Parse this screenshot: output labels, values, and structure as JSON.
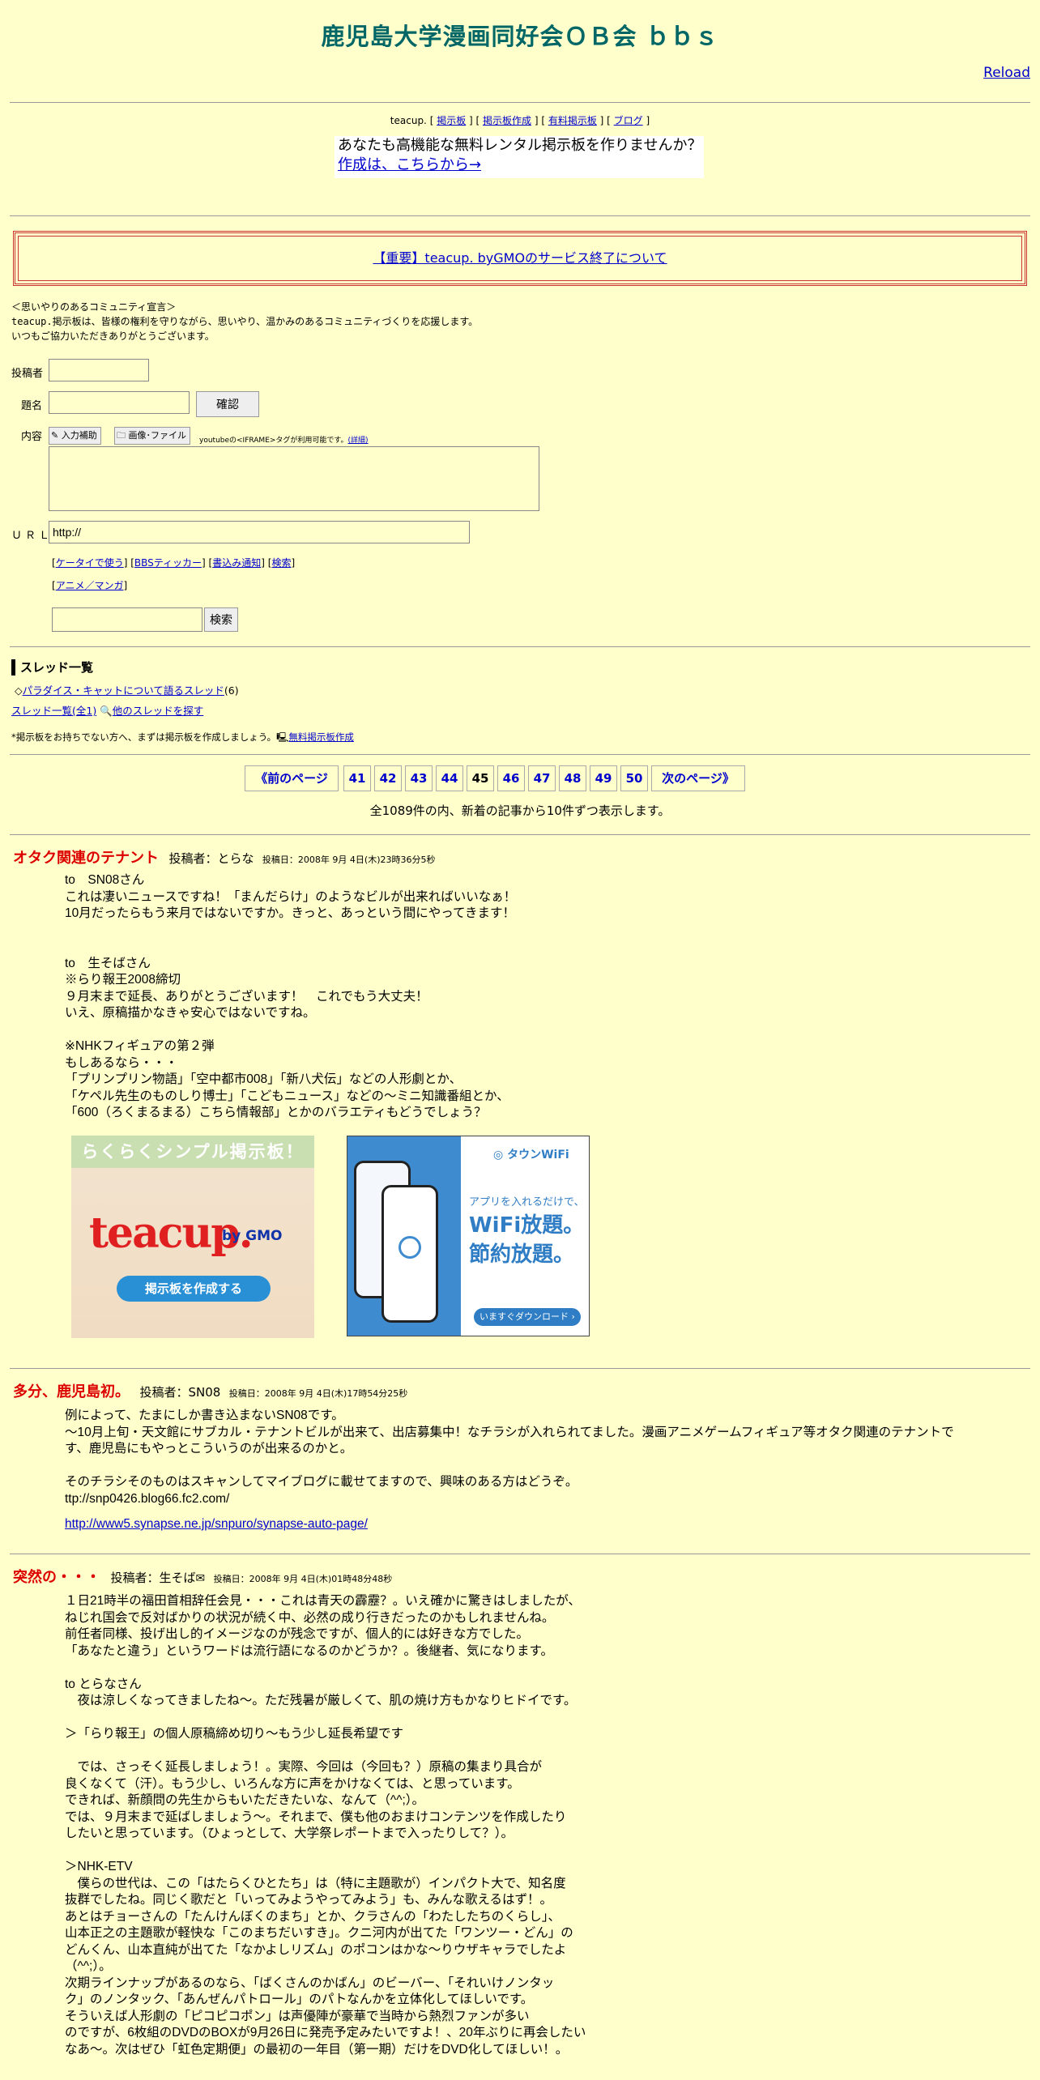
{
  "header": {
    "title": "鹿児島大学漫画同好会ＯＢ会 ｂｂｓ",
    "reload": "Reload"
  },
  "teacup_bar": {
    "prefix": "teacup.",
    "links": [
      "掲示板",
      "掲示板作成",
      "有料掲示板",
      "ブログ"
    ]
  },
  "ad": {
    "line1": "あなたも高機能な無料レンタル掲示板を作りませんか？",
    "line2": "作成は、こちらから→"
  },
  "notice": "【重要】teacup. byGMOのサービス終了について",
  "declaration": [
    "＜思いやりのあるコミュニティ宣言＞",
    "teacup.掲示板は、皆様の権利を守りながら、思いやり、温かみのあるコミュニティづくりを応援します。",
    "いつもご協力いただきありがとうございます。"
  ],
  "form": {
    "author_label": "投稿者",
    "subject_label": "題名",
    "confirm_button": "確認",
    "body_label": "内容",
    "input_help": "入力補助",
    "image_file": "画像･ファイル",
    "youtube_note": "youtubeの<IFRAME>タグが利用可能です。",
    "details": "(詳細)",
    "url_label": "ＵＲＬ",
    "url_value": "http://",
    "links1": [
      "ケータイで使う",
      "BBSティッカー",
      "書込み通知",
      "検索"
    ],
    "links2": [
      "アニメ／マンガ"
    ],
    "search_button": "検索"
  },
  "threads": {
    "title": "スレッド一覧",
    "item_prefix": "◇",
    "item_label": "パラダイス・キャットについて語るスレッド",
    "item_count": "(6)",
    "all_label": "スレッド一覧(全1)",
    "other_label": "他のスレッドを探す",
    "create_note": "*掲示板をお持ちでない方へ、まずは掲示板を作成しましょう。",
    "create_link": "無料掲示板作成"
  },
  "pager": {
    "prev": "《前のページ",
    "pages": [
      "41",
      "42",
      "43",
      "44",
      "45",
      "46",
      "47",
      "48",
      "49",
      "50"
    ],
    "current": "45",
    "next": "次のページ》",
    "summary": "全1089件の内、新着の記事から10件ずつ表示します。"
  },
  "posts": [
    {
      "title": "オタク関連のテナント",
      "author": "投稿者：とらな",
      "date": "投稿日：2008年 9月 4日(木)23時36分5秒",
      "body": "to　SN08さん\nこれは凄いニュースですね！「まんだらけ」のようなビルが出来ればいいなぁ！\n10月だったらもう来月ではないですか。きっと、あっという間にやってきます！\n\n\nto　生そばさん\n※らり報王2008締切\n９月末まで延長、ありがとうございます！　これでもう大丈夫！\nいえ、原稿描かなきゃ安心ではないですね。\n\n※NHKフィギュアの第２弾\nもしあるなら・・・\n「プリンプリン物語」「空中都市008」「新八犬伝」などの人形劇とか、\n「ケペル先生のものしり博士」「こどもニュース」などの～ミニ知識番組とか、\n「600（ろくまるまる）こちら情報部」とかのバラエティもどうでしょう？"
    },
    {
      "title": "多分、鹿児島初。",
      "author": "投稿者：SN08",
      "date": "投稿日：2008年 9月 4日(木)17時54分25秒",
      "body": "例によって、たまにしか書き込まないSN08です。\n～10月上旬・天文館にサブカル・テナントビルが出来て、出店募集中！なチラシが入れられてました。漫画アニメゲームフィギュア等オタク関連のテナントで\nす、鹿児島にもやっとこういうのが出来るのかと。\n\nそのチラシそのものはスキャンしてマイブログに載せてますので、興味のある方はどうぞ。\nttp://snp0426.blog66.fc2.com/",
      "link": "http://www5.synapse.ne.jp/snpuro/synapse-auto-page/"
    },
    {
      "title": "突然の・・・",
      "author": "投稿者：生そば",
      "date": "投稿日：2008年 9月 4日(木)01時48分48秒",
      "body": "１日21時半の福田首相辞任会見・・・これは青天の霹靂？。いえ確かに驚きはしましたが、\nねじれ国会で反対ばかりの状況が続く中、必然の成り行きだったのかもしれませんね。\n前任者同様、投げ出し的イメージなのが残念ですが、個人的には好きな方でした。\n「あなたと違う」というワードは流行語になるのかどうか？。後継者、気になります。\n\nto とらなさん\n　夜は涼しくなってきましたね～。ただ残暑が厳しくて、肌の焼け方もかなりヒドイです。\n\n＞「らり報王」の個人原稿締め切り～もう少し延長希望です\n\n　では、さっそく延長しましょう！。実際、今回は（今回も？）原稿の集まり具合が\n良くなくて（汗）。もう少し、いろんな方に声をかけなくては、と思っています。\nできれば、新顔問の先生からもいただきたいな、なんて（^^;）。\nでは、９月末まで延ばしましょう～。それまで、僕も他のおまけコンテンツを作成したり\nしたいと思っています。（ひょっとして、大学祭レポートまで入ったりして？）。\n\n＞NHK-ETV\n　僕らの世代は、この「はたらくひとたち」は（特に主題歌が）インパクト大で、知名度\n抜群でしたね。同じく歌だと「いってみようやってみよう」も、みんな歌えるはず！。\nあとはチョーさんの「たんけんぼくのまち」とか、クラさんの「わたしたちのくらし」、\n山本正之の主題歌が軽快な「このまちだいすき」。クニ河内が出てた「ワンツー・どん」の\nどんくん、山本直純が出てた「なかよしリズム」のポコンはかな～りウザキャラでしたよ\n（^^;）。\n次期ラインナップがあるのなら、「ばくさんのかばん」のビーバー、「それいけノンタッ\nク」のノンタック、「あんぜんパトロール」のパトなんかを立体化してほしいです。\nそういえば人形劇の「ピコピコポン」は声優陣が豪華で当時から熱烈ファンが多い\nのですが、6枚組のDVDのBOXが9月26日に発売予定みたいですよ！、20年ぶりに再会したい\nなあ～。次はぜひ「虹色定期便」の最初の一年目（第一期）だけをDVD化してほしい！。"
    }
  ],
  "banners": {
    "teacup": {
      "heading": "らくらくシンプル掲示板！",
      "logo": "teacup.",
      "by": "by GMO",
      "cta": "掲示板を作成する"
    },
    "wifi": {
      "brand": "タウンWiFi",
      "tagline": "アプリを入れるだけで、",
      "big1": "WiFi放題。",
      "big2": "節約放題。",
      "download": "いますぐダウンロード ›"
    }
  },
  "colors": {
    "background": "#ffffcc",
    "title": "#006666",
    "post_title": "#dd0000",
    "link": "#0000cc"
  }
}
